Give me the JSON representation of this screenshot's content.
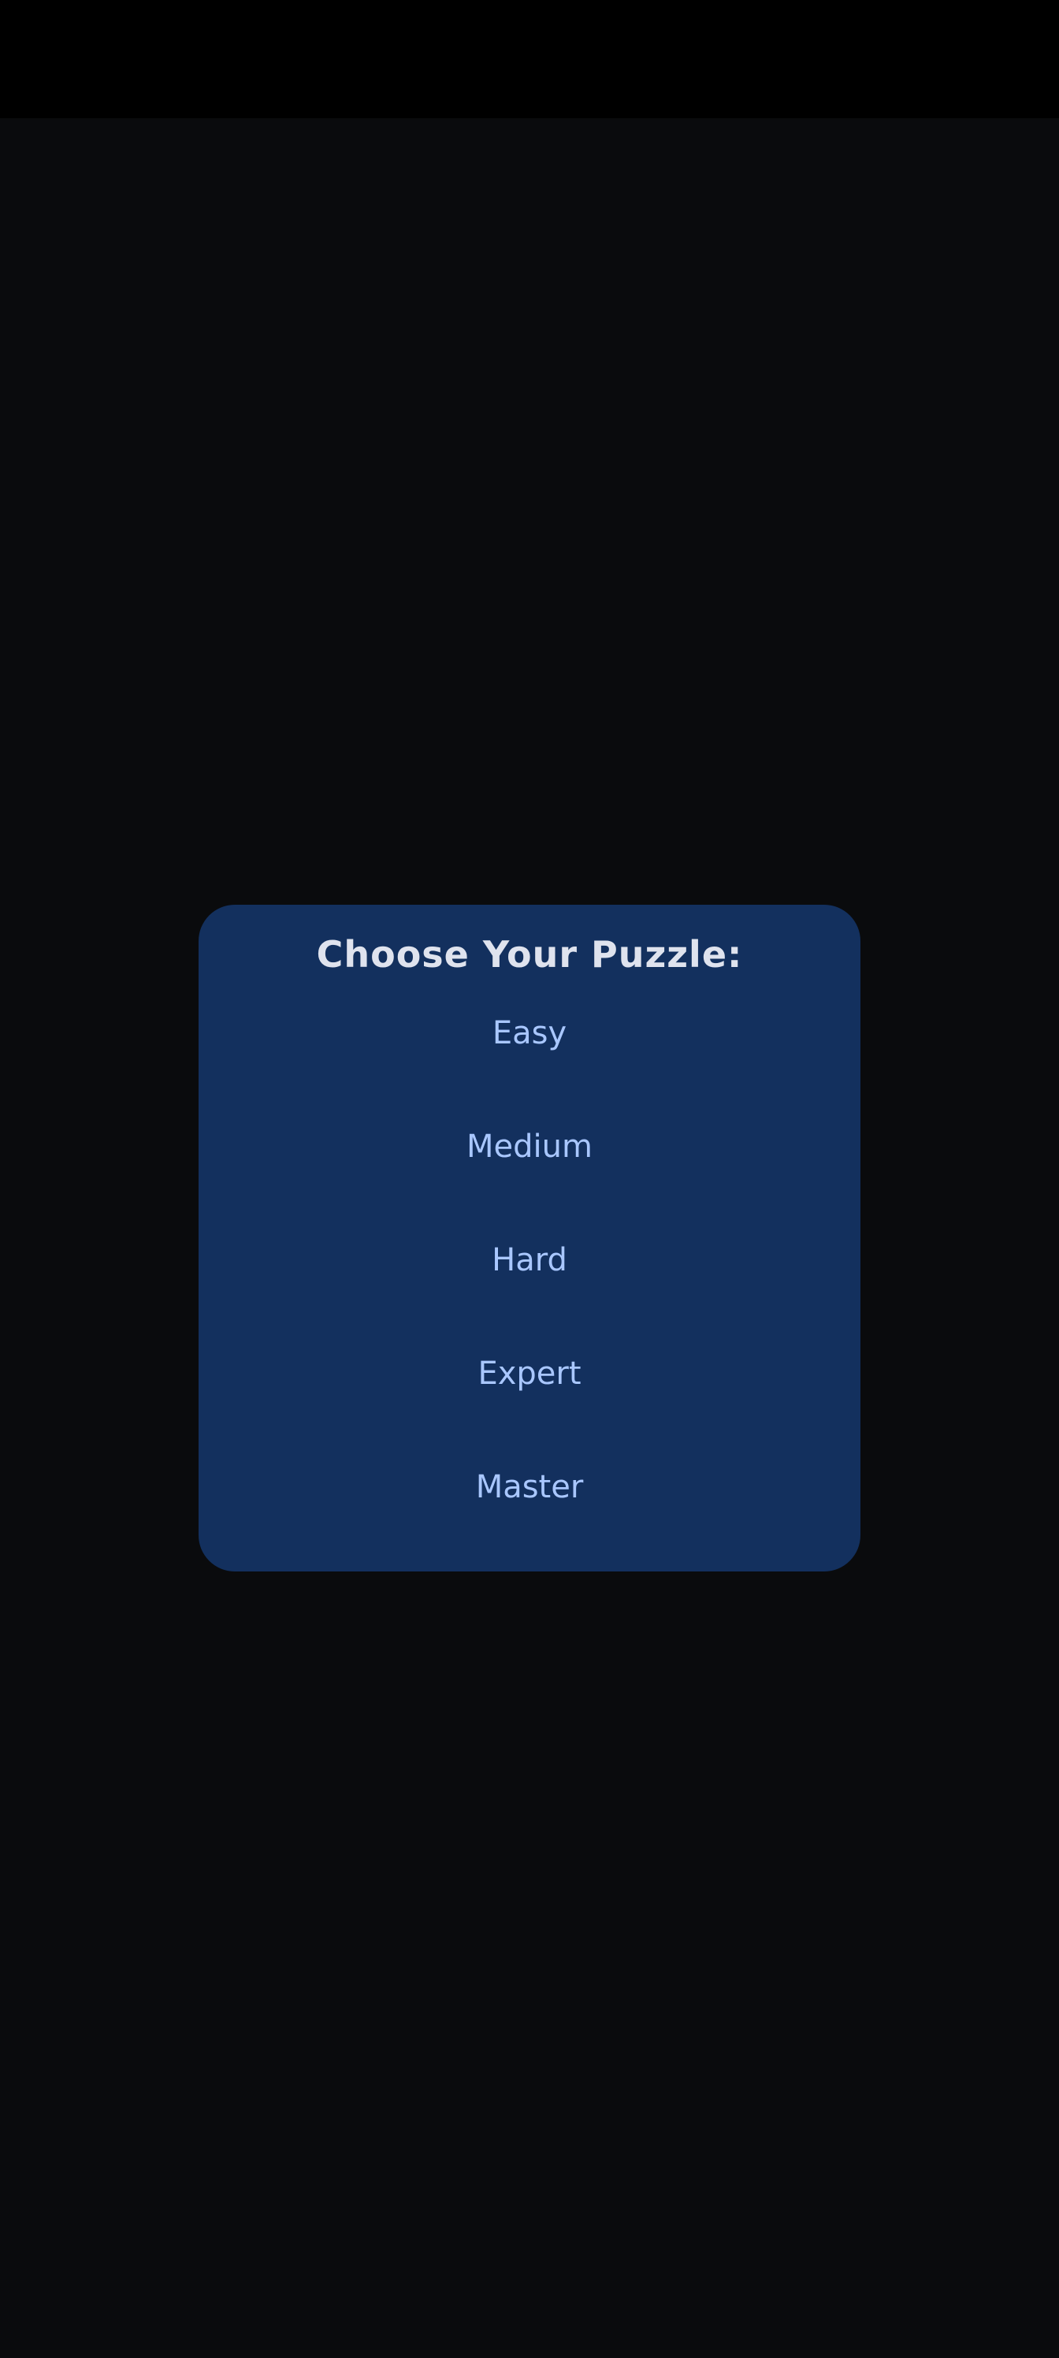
{
  "dialog": {
    "title": "Choose Your Puzzle:",
    "options": [
      {
        "label": "Easy"
      },
      {
        "label": "Medium"
      },
      {
        "label": "Hard"
      },
      {
        "label": "Expert"
      },
      {
        "label": "Master"
      }
    ]
  },
  "colors": {
    "status_bar": "#000000",
    "background": "#0a0b0d",
    "dialog_background": "#13305e",
    "title_text": "#dfe3ee",
    "option_text": "#a9c7ff"
  }
}
